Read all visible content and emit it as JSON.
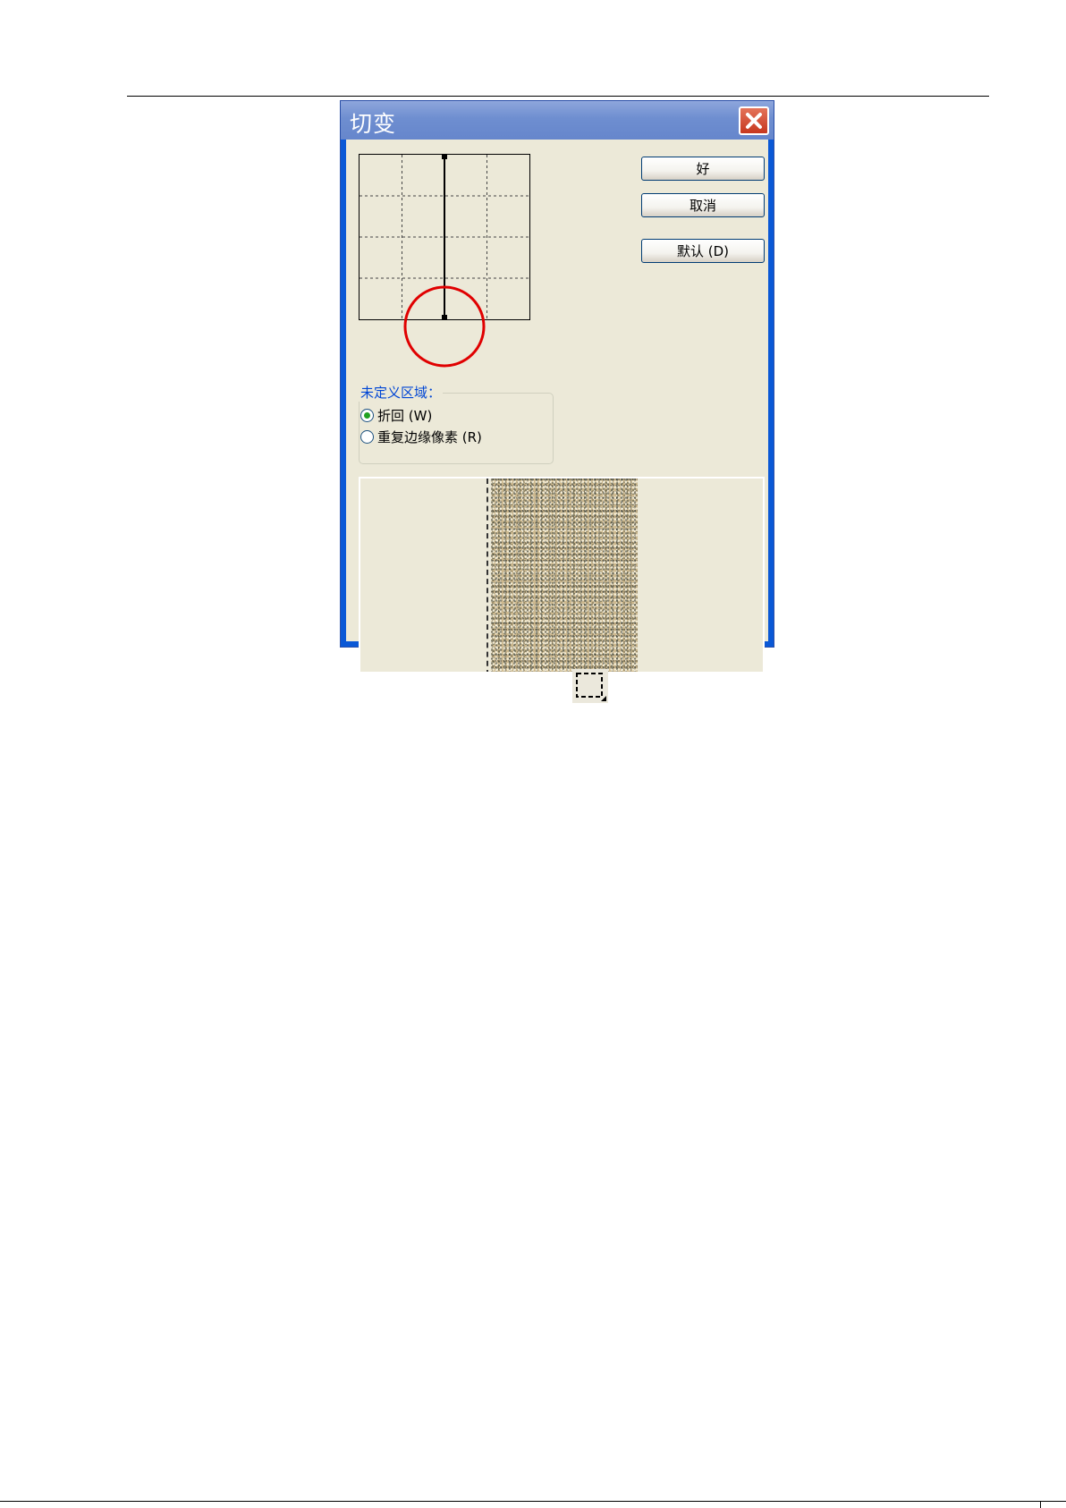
{
  "dialog": {
    "title": "切变",
    "close_icon": "close-icon",
    "buttons": {
      "ok": "好",
      "cancel": "取消",
      "default": "默认 (D)"
    },
    "undefined_area": {
      "legend": "未定义区域：",
      "options": [
        {
          "label": "折回 (W)",
          "selected": true
        },
        {
          "label": "重复边缘像素 (R)",
          "selected": false
        }
      ]
    }
  },
  "colors": {
    "title_bar": "#6e8ed0",
    "dialog_face": "#ece9d8",
    "highlight_circle": "#e00000",
    "legend_text": "#0046d5"
  },
  "icons": {
    "marquee": "rectangular-marquee-icon"
  }
}
